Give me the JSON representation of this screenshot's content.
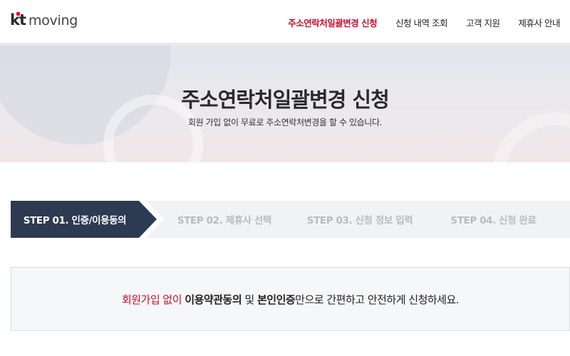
{
  "logo": {
    "kt": "kt",
    "moving": "moving"
  },
  "nav": {
    "items": [
      {
        "label": "주소연락처일괄변경 신청"
      },
      {
        "label": "신청 내역 조회"
      },
      {
        "label": "고객 지원"
      },
      {
        "label": "제휴사 안내"
      }
    ]
  },
  "hero": {
    "title": "주소연락처일괄변경 신청",
    "subtitle": "회원 가입 없이 무료로 주소연락처변경을 할 수 있습니다."
  },
  "steps": [
    {
      "label": "STEP 01. 인증/이용동의"
    },
    {
      "label": "STEP 02. 제휴사 선택"
    },
    {
      "label": "STEP 03. 신청 정보 입력"
    },
    {
      "label": "STEP 04. 신청 완료"
    }
  ],
  "info": {
    "part1": "회원가입 없이",
    "part2": " ",
    "part3": "이용약관동의",
    "part4": " 및 ",
    "part5": "본인인증",
    "part6": "만으로 간편하고 안전하게 신청하세요."
  },
  "colors": {
    "accent": "#c8102e",
    "step_active": "#2e3a52",
    "step_inactive": "#f1f2f4"
  }
}
